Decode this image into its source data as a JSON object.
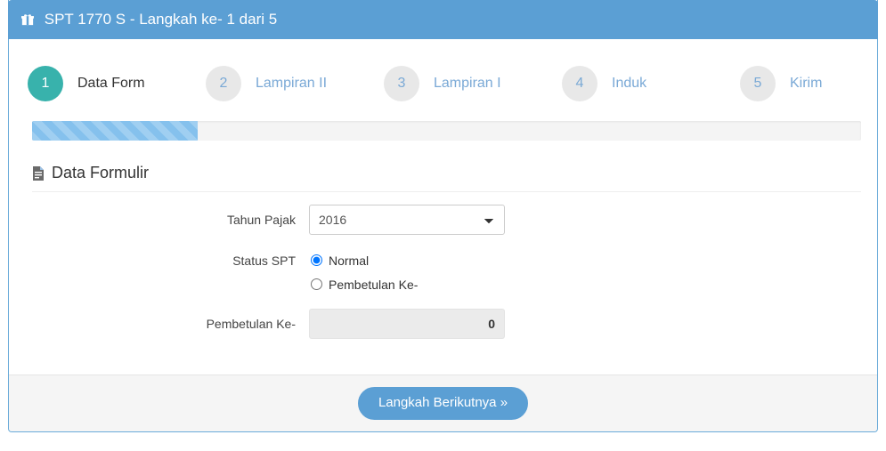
{
  "header": {
    "icon": "gift-icon",
    "title": "SPT 1770 S - Langkah ke- 1 dari 5"
  },
  "wizard": {
    "steps": [
      {
        "number": "1",
        "label": "Data Form",
        "active": true
      },
      {
        "number": "2",
        "label": "Lampiran II",
        "active": false
      },
      {
        "number": "3",
        "label": "Lampiran I",
        "active": false
      },
      {
        "number": "4",
        "label": "Induk",
        "active": false
      },
      {
        "number": "5",
        "label": "Kirim",
        "active": false
      }
    ],
    "progress_percent": 20
  },
  "section": {
    "icon": "file-icon",
    "title": "Data Formulir"
  },
  "form": {
    "tahun_pajak": {
      "label": "Tahun Pajak",
      "value": "2016",
      "options": [
        "2016"
      ]
    },
    "status_spt": {
      "label": "Status SPT",
      "options": [
        {
          "label": "Normal",
          "selected": true
        },
        {
          "label": "Pembetulan Ke-",
          "selected": false
        }
      ]
    },
    "pembetulan_ke": {
      "label": "Pembetulan Ke-",
      "value": "0",
      "disabled": true
    }
  },
  "footer": {
    "next_button": "Langkah Berikutnya »"
  },
  "colors": {
    "header_blue": "#5b9fd4",
    "active_step_teal": "#38b2ac",
    "link_blue": "#7aa9d6",
    "progress_blue": "#85c1ed",
    "footer_gray": "#f5f5f5"
  }
}
